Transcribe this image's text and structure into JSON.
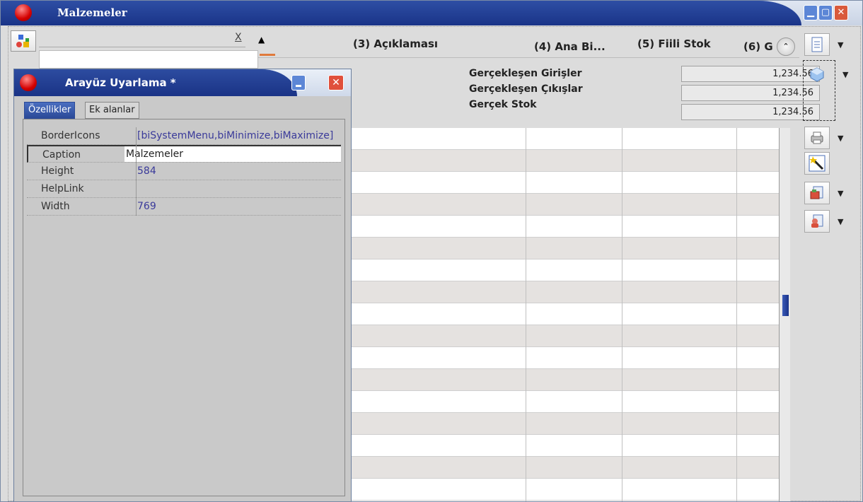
{
  "window": {
    "title": "Malzemeler",
    "controls": {
      "minimize": "▁",
      "maximize": "▢",
      "close": "✕"
    }
  },
  "filter": {
    "clear_label": "X",
    "value": ""
  },
  "columns": [
    {
      "label": "(3) Açıklaması"
    },
    {
      "label": "(4) Ana Bi..."
    },
    {
      "label": "(5) Fiili Stok"
    },
    {
      "label": "(6) G"
    }
  ],
  "totals": [
    {
      "label": "Gerçekleşen Girişler",
      "value": "1,234.56"
    },
    {
      "label": "Gerçekleşen Çıkışlar",
      "value": "1,234.56"
    },
    {
      "label": "Gerçek Stok",
      "value": "1,234.56"
    }
  ],
  "sidebar_icons": [
    "document-icon",
    "cube-icon",
    "printer-icon",
    "wand-icon",
    "report-icon",
    "document-user-icon"
  ],
  "dialog": {
    "title": "Arayüz Uyarlama *",
    "tabs": [
      {
        "label": "Özellikler"
      },
      {
        "label": "Ek alanlar"
      }
    ],
    "properties": [
      {
        "name": "BorderIcons",
        "value": "[biSystemMenu,biMinimize,biMaximize]"
      },
      {
        "name": "Caption",
        "value": "Malzemeler"
      },
      {
        "name": "Height",
        "value": "584"
      },
      {
        "name": "HelpLink",
        "value": ""
      },
      {
        "name": "Width",
        "value": "769"
      }
    ]
  },
  "colors": {
    "title_blue": "#1f3a8f",
    "close_red": "#e0503c",
    "accent_orange": "#e07a3c"
  }
}
